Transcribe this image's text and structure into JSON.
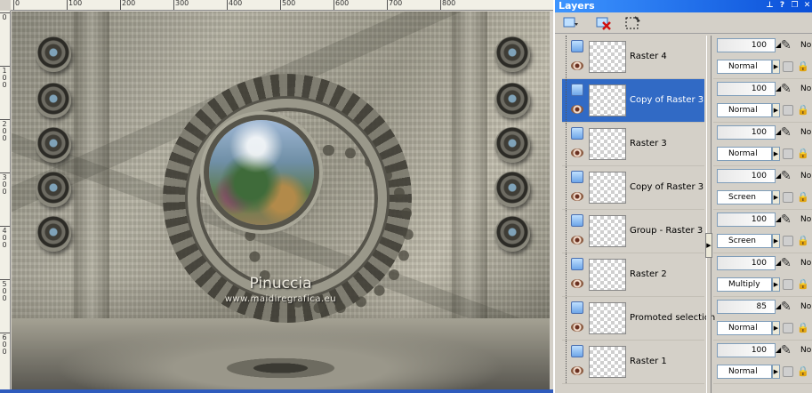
{
  "ruler_top_labels": [
    "0",
    "100",
    "200",
    "300",
    "400",
    "500",
    "600",
    "700",
    "800"
  ],
  "ruler_left_labels": [
    "0",
    "100",
    "200",
    "300",
    "400",
    "500",
    "600"
  ],
  "canvas": {
    "watermark_title": "Pinuccia",
    "watermark_url": "www.maidiregrafica.eu"
  },
  "palette": {
    "title": "Layers",
    "title_buttons": [
      "pin-icon",
      "help-icon",
      "restore-icon",
      "close-icon"
    ],
    "toolbar": [
      "new-layer-icon",
      "delete-layer-icon",
      "new-mask-icon"
    ],
    "layers": [
      {
        "name": "Raster 4",
        "opacity": "100",
        "blend": "Normal",
        "selected": false,
        "lock": true
      },
      {
        "name": "Copy of Raster 3",
        "opacity": "100",
        "blend": "Normal",
        "selected": true,
        "lock": true
      },
      {
        "name": "Raster 3",
        "opacity": "100",
        "blend": "Normal",
        "selected": false,
        "lock": true
      },
      {
        "name": "Copy of Raster 3",
        "opacity": "100",
        "blend": "Screen",
        "selected": false,
        "lock": true
      },
      {
        "name": "Group - Raster 3",
        "opacity": "100",
        "blend": "Screen",
        "selected": false,
        "lock": true
      },
      {
        "name": "Raster 2",
        "opacity": "100",
        "blend": "Multiply",
        "selected": false,
        "lock": true
      },
      {
        "name": "Promoted selection",
        "opacity": "85",
        "blend": "Normal",
        "selected": false,
        "lock": true
      },
      {
        "name": "Raster 1",
        "opacity": "100",
        "blend": "Normal",
        "selected": false,
        "lock": true
      }
    ],
    "no_label": "No"
  }
}
